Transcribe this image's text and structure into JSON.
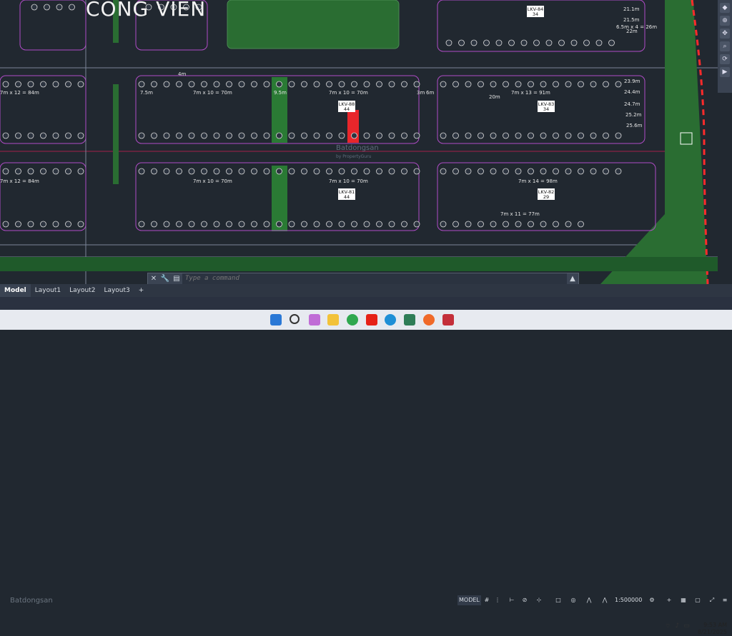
{
  "drawing": {
    "title": "CONG VIEN",
    "watermark": "Batdongsan",
    "watermark_sub": "by PropertyGuru",
    "blocks": [
      {
        "code": "LKV-84",
        "count": "34"
      },
      {
        "code": "LKV-88",
        "count": "44"
      },
      {
        "code": "LKV-83",
        "count": "34"
      },
      {
        "code": "LKV-81",
        "count": "44"
      },
      {
        "code": "LKV-82",
        "count": "29"
      }
    ],
    "dims": [
      "7m x 10 = 70m",
      "7m x 10 = 70m",
      "7m x 13 = 91m",
      "7m x 10 = 70m",
      "7m x 10 = 70m",
      "7m x 14 = 98m",
      "7m x 11 = 77m",
      "7m x 12 = 84m",
      "7m x 12 = 84m"
    ],
    "setbacks": [
      "7.5m",
      "9.5m",
      "20m",
      "6.5m x 4 = 26m",
      "21.1m",
      "21.5m",
      "22m",
      "23.9m",
      "24.4m",
      "24.7m",
      "25.2m",
      "25.6m",
      "3m",
      "6m",
      "4m"
    ]
  },
  "command": {
    "placeholder": "Type a command"
  },
  "tabs": [
    "Model",
    "Layout1",
    "Layout2",
    "Layout3",
    "+"
  ],
  "status": {
    "model_label": "MODEL",
    "scale": "1:500000"
  },
  "taskbar": {
    "time": "9:53 AM",
    "date": "8/21/2025"
  },
  "colors": {
    "background": "#212830",
    "lot_line": "#b04cc7",
    "green": "#1f6b2e",
    "highlight": "#e8262b",
    "boundary": "#ff2b2b"
  }
}
